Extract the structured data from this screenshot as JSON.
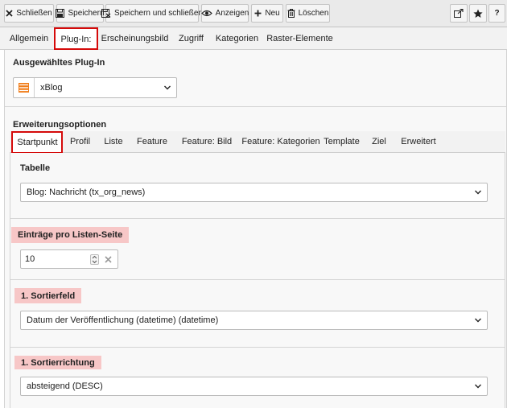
{
  "toolbar": {
    "close_label": "Schließen",
    "save_label": "Speichern",
    "save_close_label": "Speichern und schließen",
    "view_label": "Anzeigen",
    "new_label": "Neu",
    "delete_label": "Löschen",
    "help_label": "?"
  },
  "main_tabs": [
    "Allgemein",
    "Plug-In:",
    "Erscheinungsbild",
    "Zugriff",
    "Kategorien",
    "Raster-Elemente"
  ],
  "active_main_tab": "Plug-In:",
  "plugin": {
    "heading": "Ausgewähltes Plug-In",
    "selected": "xBlog"
  },
  "extensions": {
    "heading": "Erweiterungsoptionen",
    "tabs": [
      "Startpunkt",
      "Profil",
      "Liste",
      "Feature",
      "Feature: Bild",
      "Feature: Kategorien",
      "Template",
      "Ziel",
      "Erweitert"
    ],
    "active_tab": "Startpunkt"
  },
  "fields": {
    "table": {
      "label": "Tabelle",
      "value": "Blog: Nachricht (tx_org_news)"
    },
    "per_page": {
      "label": "Einträge pro Listen-Seite",
      "value": "10"
    },
    "sort1": {
      "label": "1. Sortierfeld",
      "value": "Datum der Veröffentlichung (datetime) (datetime)"
    },
    "sortdir1": {
      "label": "1. Sortierrichtung",
      "value": "absteigend (DESC)"
    }
  },
  "colors": {
    "highlight_border": "#d50a0a",
    "label_highlight": "#f7c7c7",
    "plugin_icon": "#f07d1a"
  }
}
